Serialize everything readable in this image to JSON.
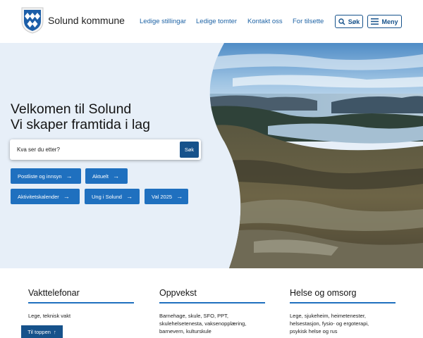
{
  "header": {
    "brand": "Solund kommune",
    "nav": [
      "Ledige stillingar",
      "Ledige tomter",
      "Kontakt oss",
      "For tilsette"
    ],
    "search_label": "Søk",
    "menu_label": "Meny"
  },
  "hero": {
    "title_line1": "Velkomen til Solund",
    "title_line2": "Vi skaper framtida i lag",
    "search_placeholder": "Kva ser du etter?",
    "search_button": "Søk",
    "quick_links": [
      "Postliste og innsyn",
      "Aktuelt",
      "Aktivitetskalender",
      "Ung i Solund",
      "Val 2025"
    ]
  },
  "sections": [
    {
      "title": "Vakttelefonar",
      "lines": [
        "Lege, teknisk vakt"
      ]
    },
    {
      "title": "Oppvekst",
      "lines": [
        "Barnehage, skule, SFO, PPT,",
        "skulehelsetenesta, vaksenopplæring,",
        "barnevern, kulturskule"
      ]
    },
    {
      "title": "Helse og omsorg",
      "lines": [
        "Lege, sjukeheim, heimetenester,",
        "helsestasjon, fysio- og ergoterapi,",
        "psykisk helse og rus"
      ]
    }
  ],
  "back_to_top": "Til toppen",
  "colors": {
    "primary": "#16528b",
    "accent": "#1f70bf",
    "hero_bg": "#e7eff8"
  },
  "icons": [
    "coat-of-arms-logo",
    "search-icon",
    "hamburger-menu-icon",
    "arrow-right-icon",
    "arrow-up-icon"
  ]
}
